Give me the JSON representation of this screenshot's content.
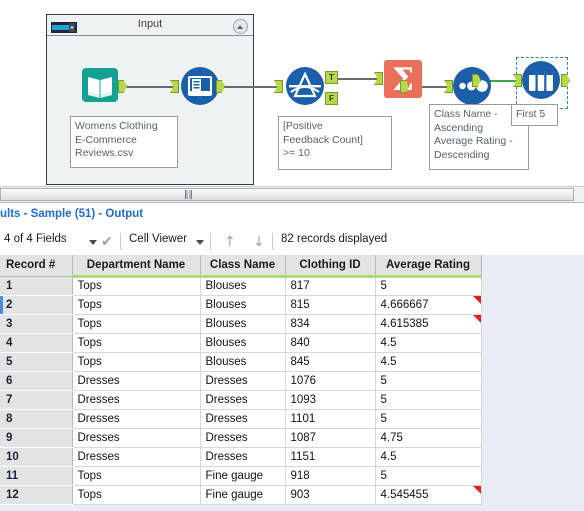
{
  "canvas": {
    "container": {
      "title": "Input",
      "icon": "container-slider-icon",
      "collapse_icon": "chevron-up-icon"
    },
    "tools": [
      {
        "name": "input-data-tool",
        "icon": "book-icon",
        "annotation": "Womens Clothing\nE-Commerce\nReviews.csv"
      },
      {
        "name": "select-tool",
        "icon": "select-icon",
        "annotation": ""
      },
      {
        "name": "filter-tool",
        "icon": "filter-icon",
        "annotation": "[Positive\nFeedback Count]\n>= 10",
        "ports": [
          {
            "label": "T"
          },
          {
            "label": "F"
          }
        ]
      },
      {
        "name": "summarize-tool",
        "icon": "sigma-icon",
        "annotation": ""
      },
      {
        "name": "sort-tool",
        "icon": "sort-dots-icon",
        "annotation": "Class Name -\nAscending\nAverage Rating -\nDescending"
      },
      {
        "name": "sample-tool",
        "icon": "test-tubes-icon",
        "annotation": "First 5",
        "selected": true
      }
    ]
  },
  "splitter": {
    "grip": "‖‖"
  },
  "results": {
    "title": "ults - Sample (51) - Output",
    "toolbar": {
      "fields_label": "4 of 4 Fields",
      "check_icon": "✔",
      "viewer_label": "Cell Viewer",
      "up_icon": "↑",
      "down_icon": "↓",
      "record_count": "82 records displayed"
    },
    "table": {
      "columns": [
        "Record #",
        "Department Name",
        "Class Name",
        "Clothing ID",
        "Average Rating"
      ],
      "rows": [
        {
          "rec": "1",
          "dept": "Tops",
          "cls": "Blouses",
          "cid": "817",
          "avg": "5",
          "flag": false,
          "selected": false
        },
        {
          "rec": "2",
          "dept": "Tops",
          "cls": "Blouses",
          "cid": "815",
          "avg": "4.666667",
          "flag": true,
          "selected": true
        },
        {
          "rec": "3",
          "dept": "Tops",
          "cls": "Blouses",
          "cid": "834",
          "avg": "4.615385",
          "flag": true,
          "selected": false
        },
        {
          "rec": "4",
          "dept": "Tops",
          "cls": "Blouses",
          "cid": "840",
          "avg": "4.5",
          "flag": false,
          "selected": false
        },
        {
          "rec": "5",
          "dept": "Tops",
          "cls": "Blouses",
          "cid": "845",
          "avg": "4.5",
          "flag": false,
          "selected": false
        },
        {
          "rec": "6",
          "dept": "Dresses",
          "cls": "Dresses",
          "cid": "1076",
          "avg": "5",
          "flag": false,
          "selected": false
        },
        {
          "rec": "7",
          "dept": "Dresses",
          "cls": "Dresses",
          "cid": "1093",
          "avg": "5",
          "flag": false,
          "selected": false
        },
        {
          "rec": "8",
          "dept": "Dresses",
          "cls": "Dresses",
          "cid": "1101",
          "avg": "5",
          "flag": false,
          "selected": false
        },
        {
          "rec": "9",
          "dept": "Dresses",
          "cls": "Dresses",
          "cid": "1087",
          "avg": "4.75",
          "flag": false,
          "selected": false
        },
        {
          "rec": "10",
          "dept": "Dresses",
          "cls": "Dresses",
          "cid": "1151",
          "avg": "4.5",
          "flag": false,
          "selected": false
        },
        {
          "rec": "11",
          "dept": "Tops",
          "cls": "Fine gauge",
          "cid": "918",
          "avg": "5",
          "flag": false,
          "selected": false
        },
        {
          "rec": "12",
          "dept": "Tops",
          "cls": "Fine gauge",
          "cid": "903",
          "avg": "4.545455",
          "flag": true,
          "selected": false
        }
      ]
    }
  },
  "colors": {
    "accent_blue": "#1f6fc4",
    "header_green": "#a9dd7a",
    "input_teal": "#13a193",
    "tool_blue": "#1a5fa8",
    "summarize_salmon": "#e8705a",
    "flag_red": "#e41f1f",
    "selection_blue": "#2b7fd4"
  }
}
